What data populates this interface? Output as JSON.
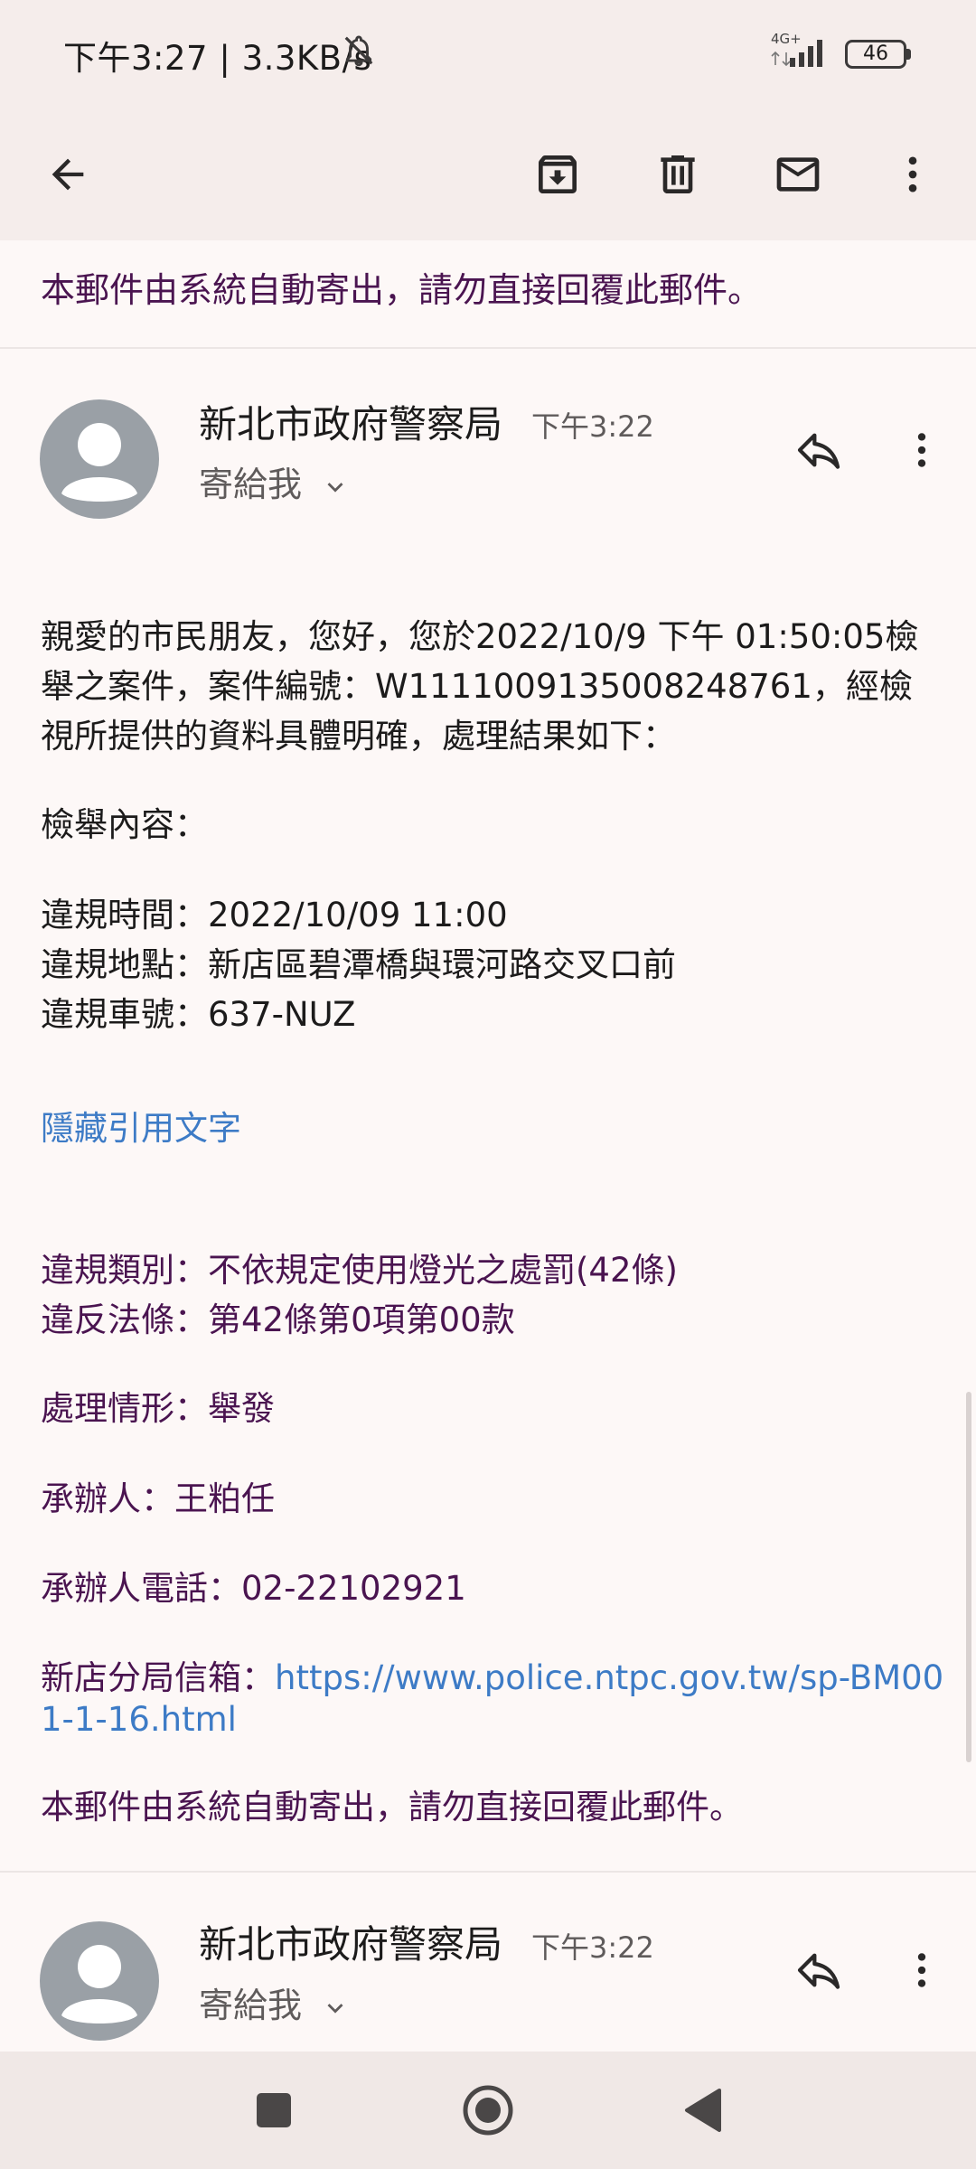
{
  "status_bar": {
    "time_speed": "下午3:27 | 3.3KB/s",
    "network": "4G+",
    "battery": "46"
  },
  "app_bar": {
    "back_icon": "arrow-back-icon",
    "archive_icon": "archive-icon",
    "delete_icon": "trash-icon",
    "mark_unread_icon": "mail-icon",
    "more_icon": "more-vert-icon"
  },
  "previous_message": {
    "footer": "本郵件由系統自動寄出，請勿直接回覆此郵件。"
  },
  "message": {
    "sender": "新北市政府警察局",
    "time": "下午3:22",
    "recipient": "寄給我",
    "intro": "親愛的市民朋友，您好，您於2022/10/9 下午 01:50:05檢舉之案件，案件編號：W1111009135008248761，經檢視所提供的資料具體明確，處理結果如下：",
    "report_heading": "檢舉內容：",
    "violation_time": "違規時間：2022/10/09 11:00",
    "violation_location": "違規地點：新店區碧潭橋與環河路交叉口前",
    "violation_plate": "違規車號：637-NUZ",
    "hide_quoted": "隱藏引用文字",
    "quoted": {
      "category": "違規類別：不依規定使用燈光之處罰(42條)",
      "law": "違反法條：第42條第0項第00款",
      "status": "處理情形：舉發",
      "handler": "承辦人：王粕任",
      "handler_phone": "承辦人電話：02-22102921",
      "mailbox_label": "新店分局信箱：",
      "mailbox_link": "https://www.police.ntpc.gov.tw/sp-BM001-1-16.html",
      "footer": "本郵件由系統自動寄出，請勿直接回覆此郵件。"
    }
  },
  "next_message": {
    "sender": "新北市政府警察局",
    "time": "下午3:22",
    "recipient": "寄給我"
  },
  "nav_bar": {
    "recents_icon": "square-icon",
    "home_icon": "circle-icon",
    "back_icon": "triangle-back-icon"
  }
}
